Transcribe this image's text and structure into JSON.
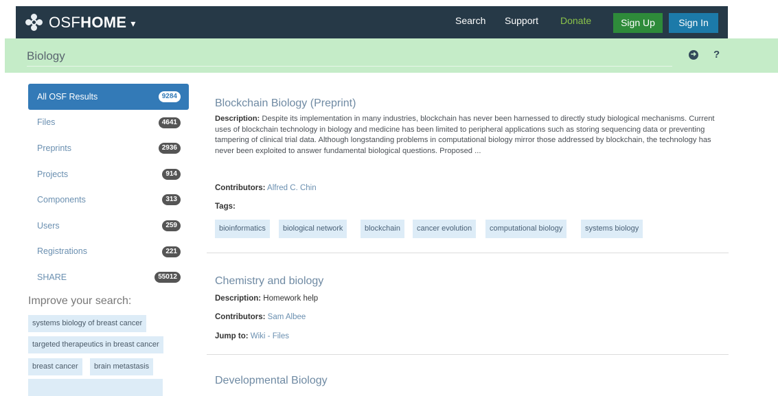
{
  "navbar": {
    "brand_light": "OSF",
    "brand_bold": "HOME",
    "caret": "▾",
    "links": [
      "Search",
      "Support",
      "Donate"
    ],
    "signup": "Sign Up",
    "signin": "Sign In"
  },
  "subheader": {
    "title": "Biology",
    "go_icon": "➜",
    "help_icon": "?"
  },
  "sidebar": {
    "items": [
      {
        "label": "All OSF Results",
        "count": "9284"
      },
      {
        "label": "Files",
        "count": "4641"
      },
      {
        "label": "Preprints",
        "count": "2936"
      },
      {
        "label": "Projects",
        "count": "914"
      },
      {
        "label": "Components",
        "count": "313"
      },
      {
        "label": "Users",
        "count": "259"
      },
      {
        "label": "Registrations",
        "count": "221"
      },
      {
        "label": "SHARE",
        "count": "55012"
      }
    ],
    "improve_title": "Improve your search:",
    "suggestions": [
      "systems biology of breast cancer",
      "targeted therapeutics in breast cancer",
      "breast cancer",
      "brain metastasis"
    ]
  },
  "results": [
    {
      "title": "Blockchain Biology (Preprint)",
      "desc_label": "Description:",
      "desc_text": "Despite its implementation in many industries, blockchain has never been harnessed to directly study biological mechanisms. Current uses of blockchain technology in biology and medicine has been limited to peripheral applications such as storing sequencing data or preventing tampering of clinical trial data. Although longstanding problems in computational biology mirror those addressed by blockchain, the technology has never been exploited to answer fundamental biological questions. Proposed ...",
      "contributors_label": "Contributors:",
      "contributors": "Alfred C. Chin",
      "tags_label": "Tags:",
      "tags": [
        "bioinformatics",
        "biological network",
        "blockchain",
        "cancer evolution",
        "computational biology",
        "systems biology"
      ]
    },
    {
      "title": "Chemistry and biology",
      "desc_label": "Description:",
      "desc_text": "Homework help",
      "contributors_label": "Contributors:",
      "contributors": "Sam Albee",
      "jump_label": "Jump to:",
      "jump_links": "Wiki - Files"
    },
    {
      "title": "Developmental Biology"
    }
  ]
}
